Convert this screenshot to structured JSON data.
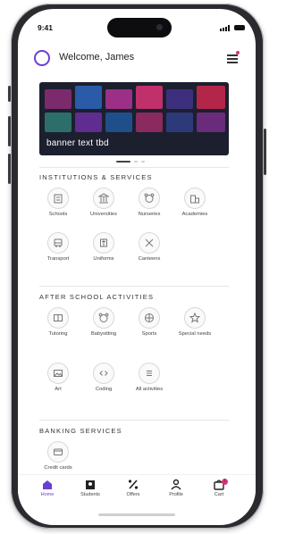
{
  "status_bar": {
    "time": "9:41"
  },
  "header": {
    "welcome": "Welcome, James"
  },
  "banner": {
    "text": "banner text tbd"
  },
  "colors": {
    "accent": "#6a3fd4",
    "badge": "#e0307a"
  },
  "sections": {
    "institutions": {
      "title": "INSTITUTIONS & SERVICES",
      "items": [
        {
          "label": "Schools",
          "icon": "school-icon"
        },
        {
          "label": "Universities",
          "icon": "university-icon"
        },
        {
          "label": "Nurseries",
          "icon": "nursery-icon"
        },
        {
          "label": "Academies",
          "icon": "academy-icon"
        },
        {
          "label": "Transport",
          "icon": "bus-icon"
        },
        {
          "label": "Uniforms",
          "icon": "uniform-icon"
        },
        {
          "label": "Canteens",
          "icon": "utensils-icon"
        }
      ]
    },
    "after_school": {
      "title": "AFTER SCHOOL ACTIVITIES",
      "items": [
        {
          "label": "Tutoring",
          "icon": "book-icon"
        },
        {
          "label": "Babysitting",
          "icon": "baby-icon"
        },
        {
          "label": "Sports",
          "icon": "ball-icon"
        },
        {
          "label": "Special needs",
          "icon": "star-icon"
        },
        {
          "label": "Art",
          "icon": "image-icon"
        },
        {
          "label": "Coding",
          "icon": "code-icon"
        },
        {
          "label": "All activities",
          "icon": "list-icon"
        }
      ]
    },
    "banking": {
      "title": "BANKING SERVICES",
      "items": [
        {
          "label": "Credit cards",
          "icon": "credit-card-icon"
        }
      ]
    }
  },
  "tabbar": {
    "items": [
      {
        "label": "Home",
        "icon": "home-icon",
        "active": true
      },
      {
        "label": "Students",
        "icon": "students-icon"
      },
      {
        "label": "Offers",
        "icon": "percent-icon"
      },
      {
        "label": "Profile",
        "icon": "profile-icon"
      },
      {
        "label": "Cart",
        "icon": "cart-icon",
        "badge": "1"
      }
    ]
  }
}
